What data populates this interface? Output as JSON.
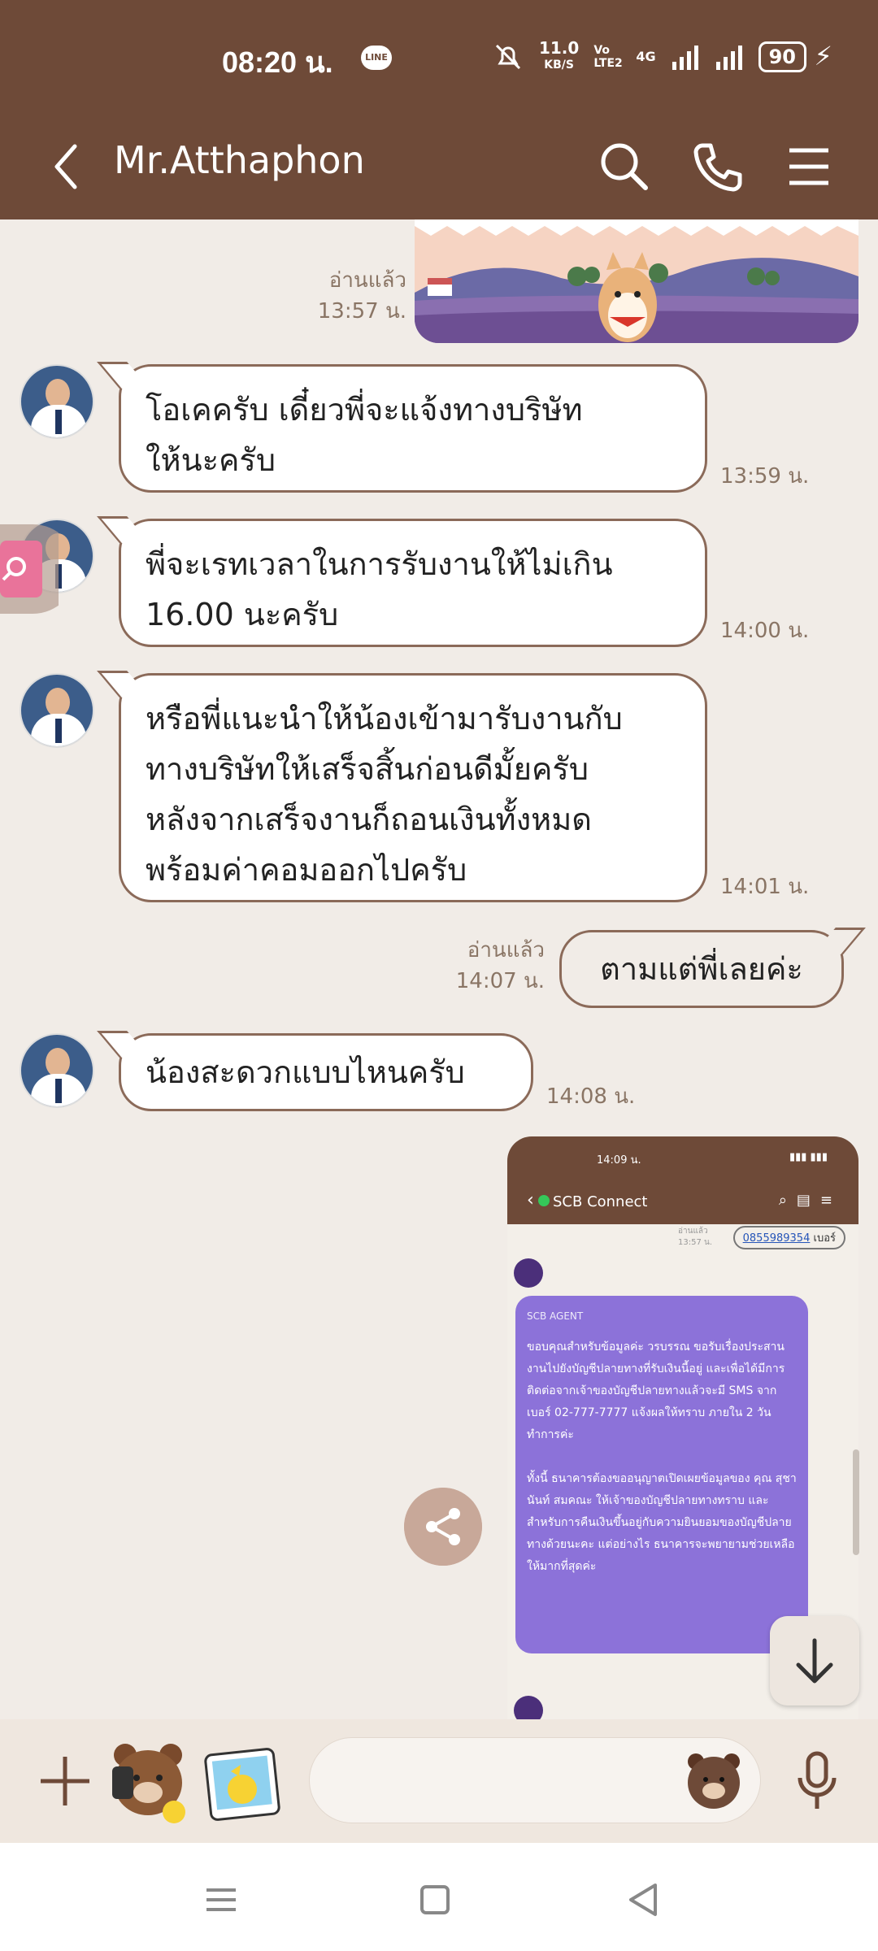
{
  "status": {
    "time": "08:20 น.",
    "line_label": "LINE",
    "net_speed_top": "11.0",
    "net_speed_bottom": "KB/S",
    "volte": "Vo LTE2",
    "signal_type": "4G",
    "battery": "90"
  },
  "header": {
    "title": "Mr.Atthaphon"
  },
  "messages": [
    {
      "side": "right",
      "type": "sticker",
      "read": "อ่านแล้ว",
      "time": "13:57 น."
    },
    {
      "side": "left",
      "text_lines": [
        "โอเคครับ เดี๋ยวพี่จะแจ้งทางบริษัท",
        "ให้นะครับ"
      ],
      "time": "13:59 น."
    },
    {
      "side": "left",
      "text_lines": [
        "พี่จะเรทเวลาในการรับงานให้ไม่เกิน",
        "16.00 นะครับ"
      ],
      "time": "14:00 น."
    },
    {
      "side": "left",
      "text_lines": [
        "หรือพี่แนะนำให้น้องเข้ามารับงานกับ",
        "ทางบริษัทให้เสร็จสิ้นก่อนดีมั้ยครับ",
        "หลังจากเสร็จงานก็ถอนเงินทั้งหมด",
        "พร้อมค่าคอมออกไปครับ"
      ],
      "time": "14:01 น."
    },
    {
      "side": "right",
      "text": "ตามแต่พี่เลยค่ะ",
      "read": "อ่านแล้ว",
      "time": "14:07 น."
    },
    {
      "side": "left",
      "text": "น้องสะดวกแบบไหนครับ",
      "time": "14:08 น."
    }
  ],
  "screenshot": {
    "status_time": "14:09 น.",
    "chat_name": "SCB Connect",
    "phone_number": "0855989354",
    "phone_suffix": "เบอร์",
    "meta_read": "อ่านแล้ว",
    "meta_time": "13:57 น.",
    "agent_label": "SCB AGENT",
    "body": "ขอบคุณสำหรับข้อมูลค่ะ วรบรรณ ขอรับเรื่องประสานงานไปยังบัญชีปลายทางที่รับเงินนี้อยู่ และเพื่อได้มีการติดต่อจากเจ้าของบัญชีปลายทางแล้วจะมี SMS จากเบอร์ 02-777-7777 แจ้งผลให้ทราบ ภายใน 2 วันทำการค่ะ\n\nทั้งนี้ ธนาคารต้องขออนุญาตเปิดเผยข้อมูลของ คุณ สุชานันท์ สมคณะ ให้เจ้าของบัญชีปลายทางทราบ และสำหรับการคืนเงินขึ้นอยู่กับความยินยอมของบัญชีปลายทางด้วยนะคะ แต่อย่างไร ธนาคารจะพยายามช่วยเหลือให้มากที่สุดค่ะ"
  },
  "colors": {
    "header_bg": "#6e4a38",
    "chat_bg": "#f1ece7",
    "bubble_border": "#8b6a59",
    "agent_bubble": "#8c72d9"
  }
}
